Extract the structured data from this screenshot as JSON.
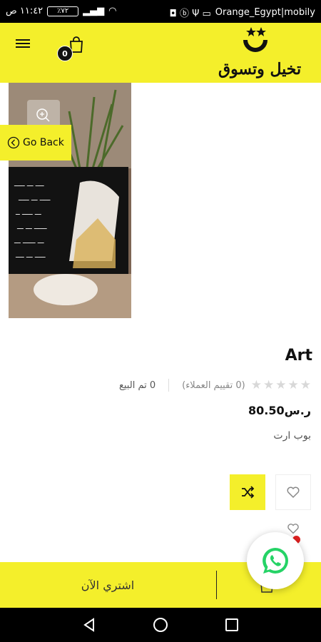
{
  "status_bar": {
    "time": "١١:٤٢ ص",
    "battery": "٪٧٢",
    "carrier": "Orange_Egypt|mobily"
  },
  "header": {
    "logo_text": "تخيل وتسوق",
    "cart_count": "0",
    "brand_color": "#f4ef2b"
  },
  "product": {
    "go_back_label": "Go Back",
    "title": "Art",
    "reviews_label": "(0 تقييم العملاء)",
    "sold_label": "0 تم البيع",
    "rating": 0,
    "rating_max": 5,
    "price": "ر.س80.50",
    "description": "بوب ارت"
  },
  "actions": {
    "buy_now_label": "اشتري الآن"
  },
  "icons": {
    "menu": "menu-icon",
    "cart": "shopping-bag-icon",
    "zoom": "zoom-in-icon",
    "compare": "shuffle-icon",
    "wishlist": "heart-icon",
    "whatsapp": "whatsapp-icon"
  }
}
